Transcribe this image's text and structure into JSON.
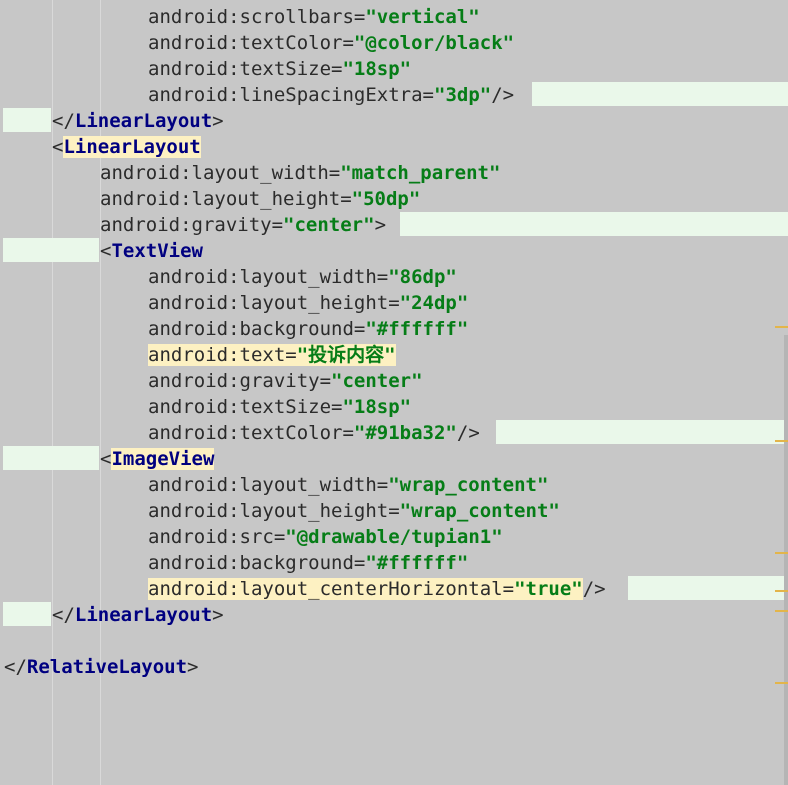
{
  "editor": {
    "lines": [
      {
        "indent": 148,
        "kind": "attr",
        "attr": "android:scrollbars",
        "value": "\"vertical\"",
        "after": ""
      },
      {
        "indent": 148,
        "kind": "attr",
        "attr": "android:textColor",
        "value": "\"@color/black\"",
        "after": ""
      },
      {
        "indent": 148,
        "kind": "attr",
        "attr": "android:textSize",
        "value": "\"18sp\"",
        "after": ""
      },
      {
        "indent": 148,
        "kind": "attr",
        "attr": "android:lineSpacingExtra",
        "value": "\"3dp\"",
        "after": "/>"
      },
      {
        "indent": 52,
        "kind": "close",
        "tag": "LinearLayout"
      },
      {
        "indent": 52,
        "kind": "open",
        "tag": "LinearLayout",
        "highlight": true
      },
      {
        "indent": 100,
        "kind": "attr",
        "attr": "android:layout_width",
        "value": "\"match_parent\"",
        "after": ""
      },
      {
        "indent": 100,
        "kind": "attr",
        "attr": "android:layout_height",
        "value": "\"50dp\"",
        "after": ""
      },
      {
        "indent": 100,
        "kind": "attr",
        "attr": "android:gravity",
        "value": "\"center\"",
        "after": ">"
      },
      {
        "indent": 100,
        "kind": "open",
        "tag": "TextView",
        "highlight": false
      },
      {
        "indent": 148,
        "kind": "attr",
        "attr": "android:layout_width",
        "value": "\"86dp\"",
        "after": ""
      },
      {
        "indent": 148,
        "kind": "attr",
        "attr": "android:layout_height",
        "value": "\"24dp\"",
        "after": ""
      },
      {
        "indent": 148,
        "kind": "attr",
        "attr": "android:background",
        "value": "\"#ffffff\"",
        "after": ""
      },
      {
        "indent": 148,
        "kind": "attr",
        "attr": "android:text",
        "value": "\"投诉内容\"",
        "after": "",
        "highlight": true
      },
      {
        "indent": 148,
        "kind": "attr",
        "attr": "android:gravity",
        "value": "\"center\"",
        "after": ""
      },
      {
        "indent": 148,
        "kind": "attr",
        "attr": "android:textSize",
        "value": "\"18sp\"",
        "after": ""
      },
      {
        "indent": 148,
        "kind": "attr",
        "attr": "android:textColor",
        "value": "\"#91ba32\"",
        "after": "/>"
      },
      {
        "indent": 100,
        "kind": "open",
        "tag": "ImageView",
        "highlight": true
      },
      {
        "indent": 148,
        "kind": "attr",
        "attr": "android:layout_width",
        "value": "\"wrap_content\"",
        "after": ""
      },
      {
        "indent": 148,
        "kind": "attr",
        "attr": "android:layout_height",
        "value": "\"wrap_content\"",
        "after": ""
      },
      {
        "indent": 148,
        "kind": "attr",
        "attr": "android:src",
        "value": "\"@drawable/tupian1\"",
        "after": ""
      },
      {
        "indent": 148,
        "kind": "attr",
        "attr": "android:background",
        "value": "\"#ffffff\"",
        "after": ""
      },
      {
        "indent": 148,
        "kind": "attr",
        "attr": "android:layout_centerHorizontal",
        "value": "\"true\"",
        "after": "/>",
        "highlight": true
      },
      {
        "indent": 52,
        "kind": "close",
        "tag": "LinearLayout"
      },
      {
        "indent": 0,
        "kind": "blank"
      },
      {
        "indent": 4,
        "kind": "close",
        "tag": "RelativeLayout"
      }
    ]
  }
}
